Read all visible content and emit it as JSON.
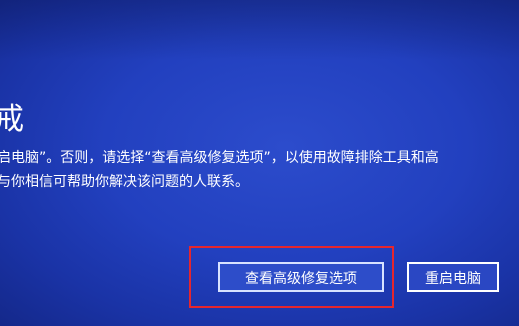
{
  "screen": {
    "title": "戒",
    "message_lines": [
      "启电脑”。否则，请选择“查看高级修复选项”，以使用故障排除工具和高",
      "与你相信可帮助你解决该问题的人联系。"
    ]
  },
  "buttons": {
    "advanced_label": "查看高级修复选项",
    "restart_label": "重启电脑"
  },
  "colors": {
    "background": "#2240bf",
    "text": "#ffffff",
    "highlight": "#e6262d"
  }
}
